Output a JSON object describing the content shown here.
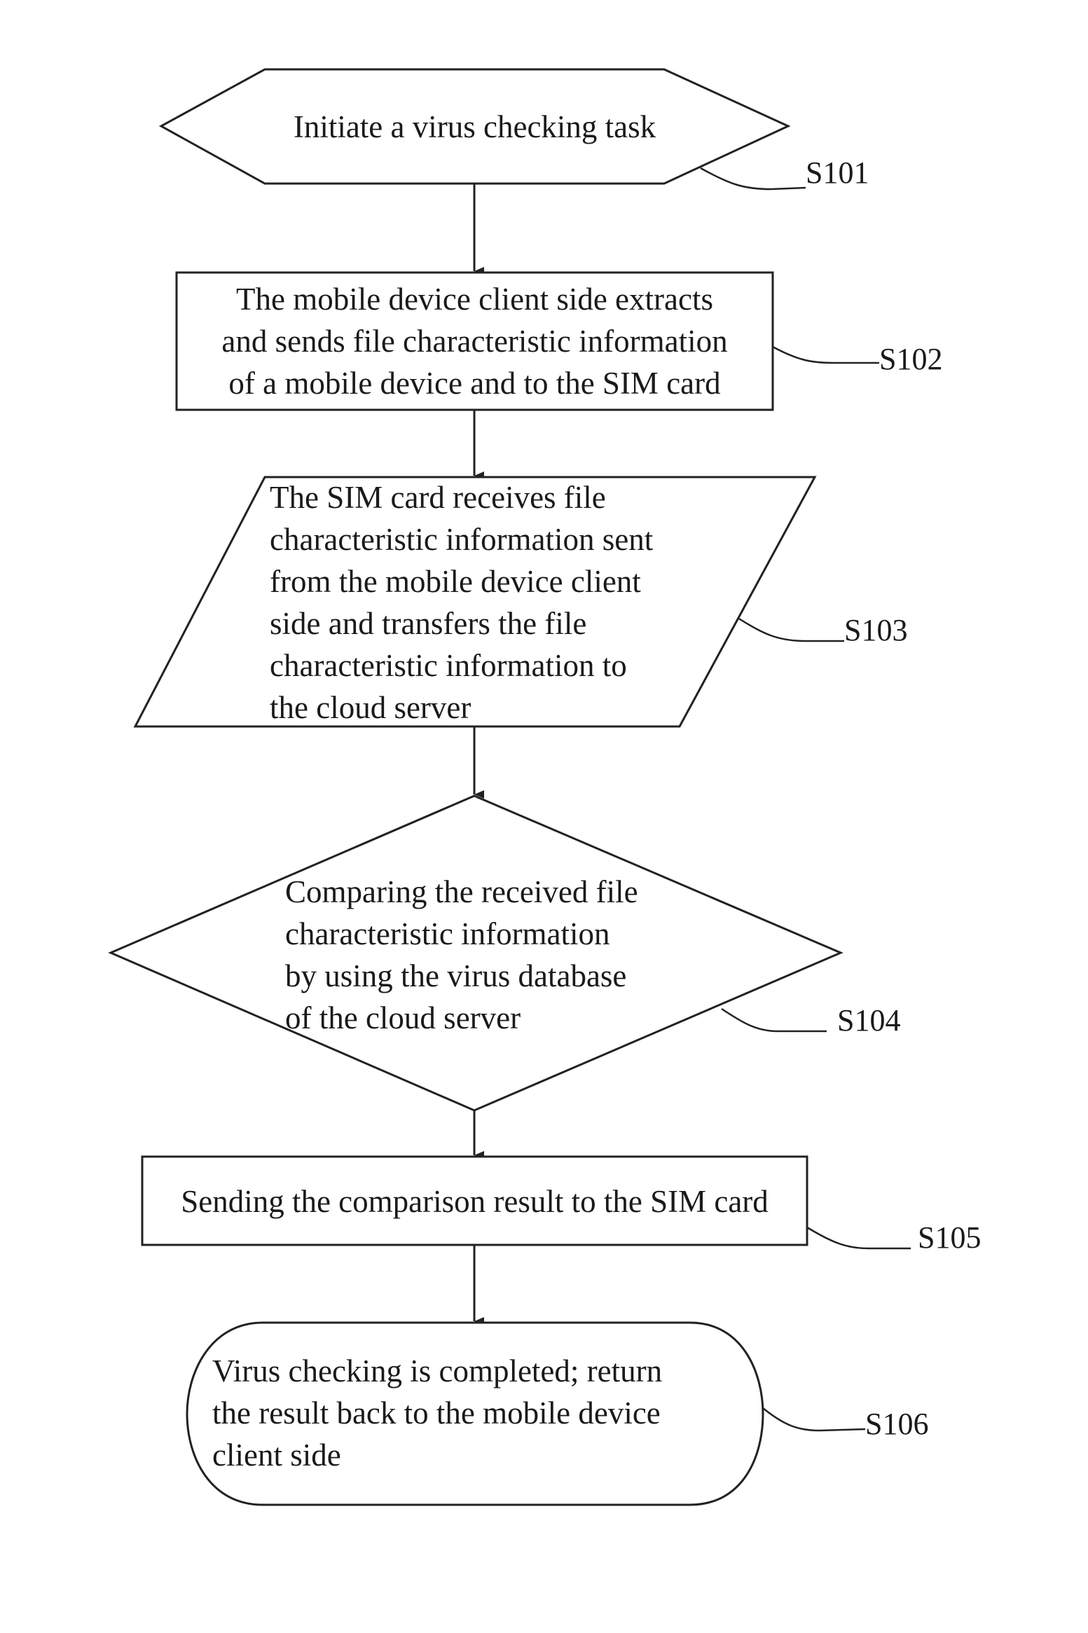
{
  "figure": {
    "type": "flowchart",
    "steps": [
      {
        "id": "S101",
        "shape": "hexagon",
        "lines": [
          "Initiate a virus checking task"
        ]
      },
      {
        "id": "S102",
        "shape": "rectangle",
        "lines": [
          "The mobile device client side extracts",
          "and sends file characteristic information",
          "of a mobile device and to the SIM card"
        ]
      },
      {
        "id": "S103",
        "shape": "parallelogram",
        "lines": [
          "The SIM card receives file",
          "characteristic information sent",
          "from the mobile device client",
          "side and transfers the file",
          "characteristic information to",
          "the cloud server"
        ]
      },
      {
        "id": "S104",
        "shape": "diamond",
        "lines": [
          "Comparing the received file",
          "characteristic information",
          "by using the virus database",
          "of the cloud server"
        ]
      },
      {
        "id": "S105",
        "shape": "rectangle",
        "lines": [
          "Sending the comparison result to the SIM card"
        ]
      },
      {
        "id": "S106",
        "shape": "terminal",
        "lines": [
          "Virus checking is completed; return",
          "the result back to the mobile device",
          "client side"
        ]
      }
    ],
    "edges": [
      {
        "from": "S101",
        "to": "S102"
      },
      {
        "from": "S102",
        "to": "S103"
      },
      {
        "from": "S103",
        "to": "S104"
      },
      {
        "from": "S104",
        "to": "S105"
      },
      {
        "from": "S105",
        "to": "S106"
      }
    ]
  }
}
